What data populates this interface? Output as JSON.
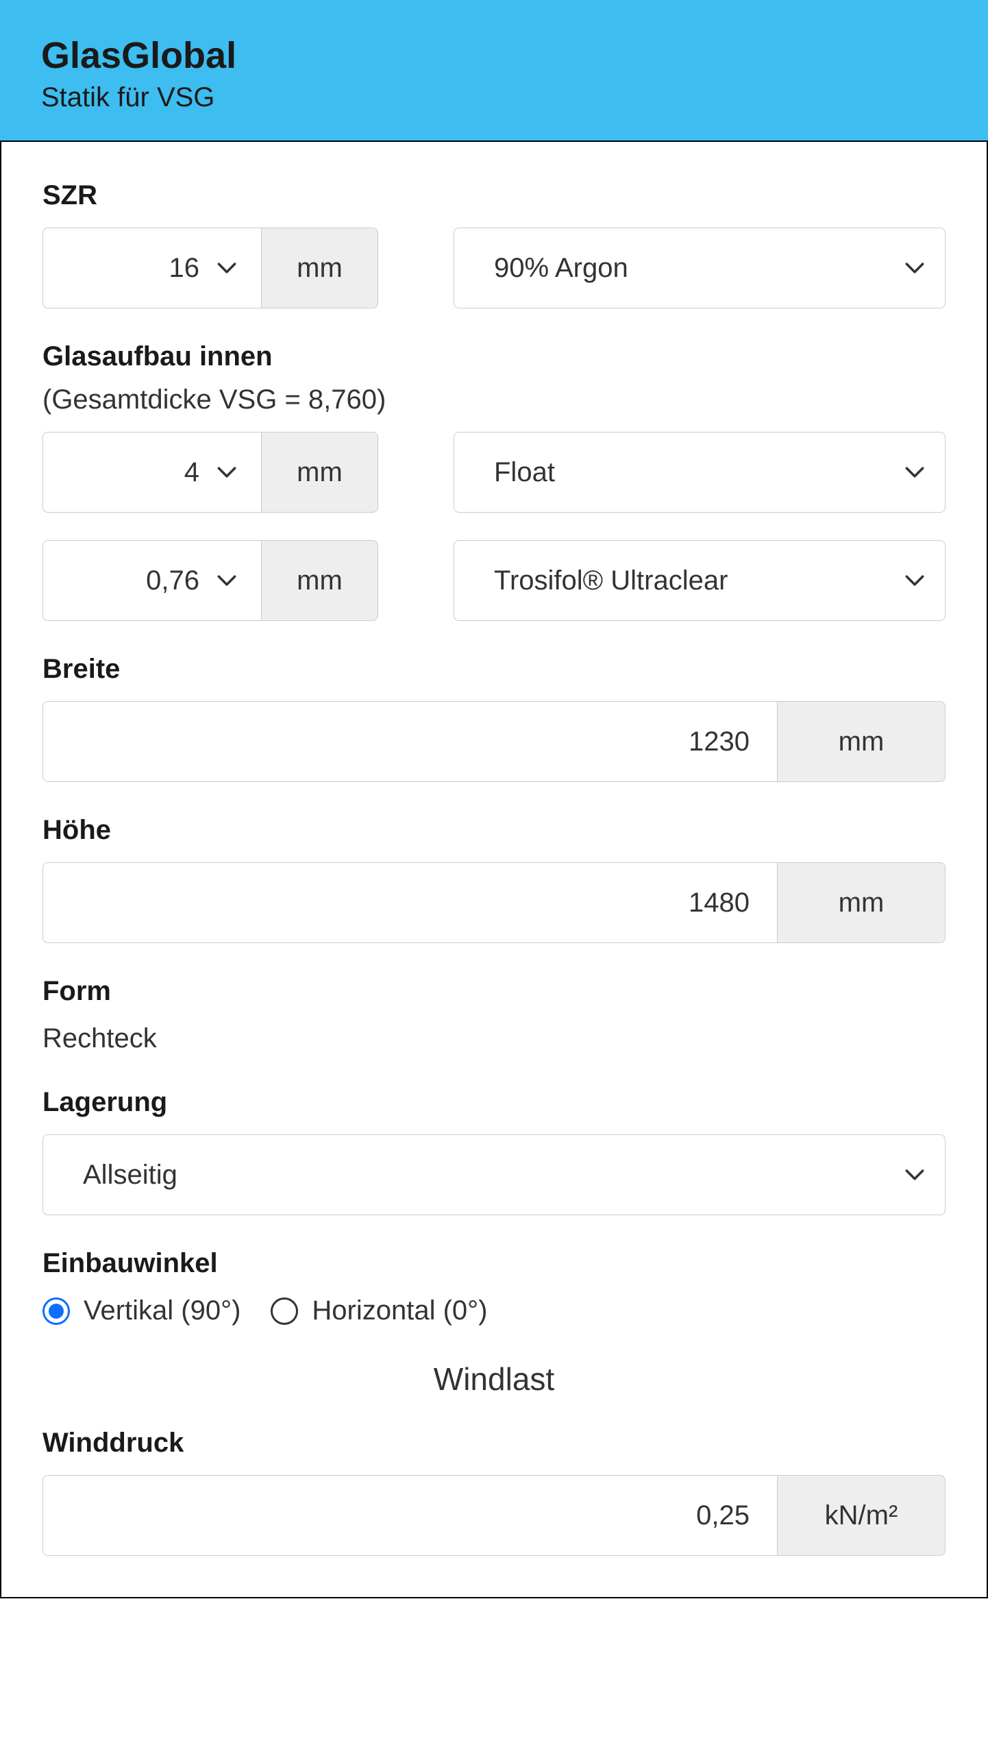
{
  "header": {
    "title": "GlasGlobal",
    "subtitle": "Statik für VSG"
  },
  "units": {
    "mm": "mm",
    "knm2": "kN/m²"
  },
  "szr": {
    "label": "SZR",
    "thickness": "16",
    "gas": "90% Argon"
  },
  "glasaufbau_innen": {
    "label": "Glasaufbau innen",
    "sublabel": "(Gesamtdicke VSG = 8,760)",
    "layer1_thickness": "4",
    "layer1_material": "Float",
    "layer2_thickness": "0,76",
    "layer2_material": "Trosifol® Ultraclear"
  },
  "breite": {
    "label": "Breite",
    "value": "1230"
  },
  "hoehe": {
    "label": "Höhe",
    "value": "1480"
  },
  "form": {
    "label": "Form",
    "value": "Rechteck"
  },
  "lagerung": {
    "label": "Lagerung",
    "value": "Allseitig"
  },
  "einbauwinkel": {
    "label": "Einbauwinkel",
    "options": {
      "vertikal": "Vertikal (90°)",
      "horizontal": "Horizontal (0°)"
    },
    "selected": "vertikal"
  },
  "windlast": {
    "heading": "Windlast"
  },
  "winddruck": {
    "label": "Winddruck",
    "value": "0,25"
  }
}
